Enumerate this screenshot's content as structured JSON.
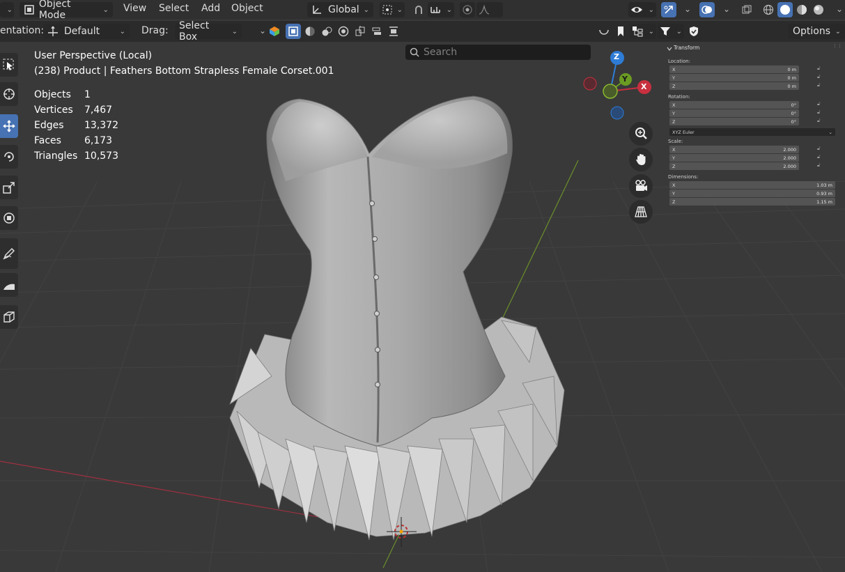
{
  "header": {
    "mode_label": "Object Mode",
    "menus": [
      "View",
      "Select",
      "Add",
      "Object"
    ],
    "transform_orientation": "Global"
  },
  "tool_header": {
    "orientation_label": "entation:",
    "orientation_value": "Default",
    "drag_label": "Drag:",
    "drag_value": "Select Box",
    "search_placeholder": "Search",
    "options_label": "Options"
  },
  "viewport": {
    "view_name": "User Perspective (Local)",
    "object_info": "(238) Product | Feathers Bottom Strapless Female Corset.001",
    "stats": [
      {
        "label": "Objects",
        "value": "1"
      },
      {
        "label": "Vertices",
        "value": "7,467"
      },
      {
        "label": "Edges",
        "value": "13,372"
      },
      {
        "label": "Faces",
        "value": "6,173"
      },
      {
        "label": "Triangles",
        "value": "10,573"
      }
    ],
    "gizmo_axes": {
      "z": "Z",
      "y": "Y",
      "x": "X"
    },
    "colors": {
      "x_axis": "#c8303f",
      "y_axis": "#6b9b23",
      "z_axis": "#2e7cd6",
      "background": "#393939"
    }
  },
  "sidebar": {
    "panel_title": "Transform",
    "location_label": "Location:",
    "location": [
      {
        "axis": "X",
        "value": "0 m"
      },
      {
        "axis": "Y",
        "value": "0 m"
      },
      {
        "axis": "Z",
        "value": "0 m"
      }
    ],
    "rotation_label": "Rotation:",
    "rotation": [
      {
        "axis": "X",
        "value": "0°"
      },
      {
        "axis": "Y",
        "value": "0°"
      },
      {
        "axis": "Z",
        "value": "0°"
      }
    ],
    "rotation_mode": "XYZ Euler",
    "scale_label": "Scale:",
    "scale": [
      {
        "axis": "X",
        "value": "2.000"
      },
      {
        "axis": "Y",
        "value": "2.000"
      },
      {
        "axis": "Z",
        "value": "2.000"
      }
    ],
    "dimensions_label": "Dimensions:",
    "dimensions": [
      {
        "axis": "X",
        "value": "1.03 m"
      },
      {
        "axis": "Y",
        "value": "0.93 m"
      },
      {
        "axis": "Z",
        "value": "1.15 m"
      }
    ]
  }
}
